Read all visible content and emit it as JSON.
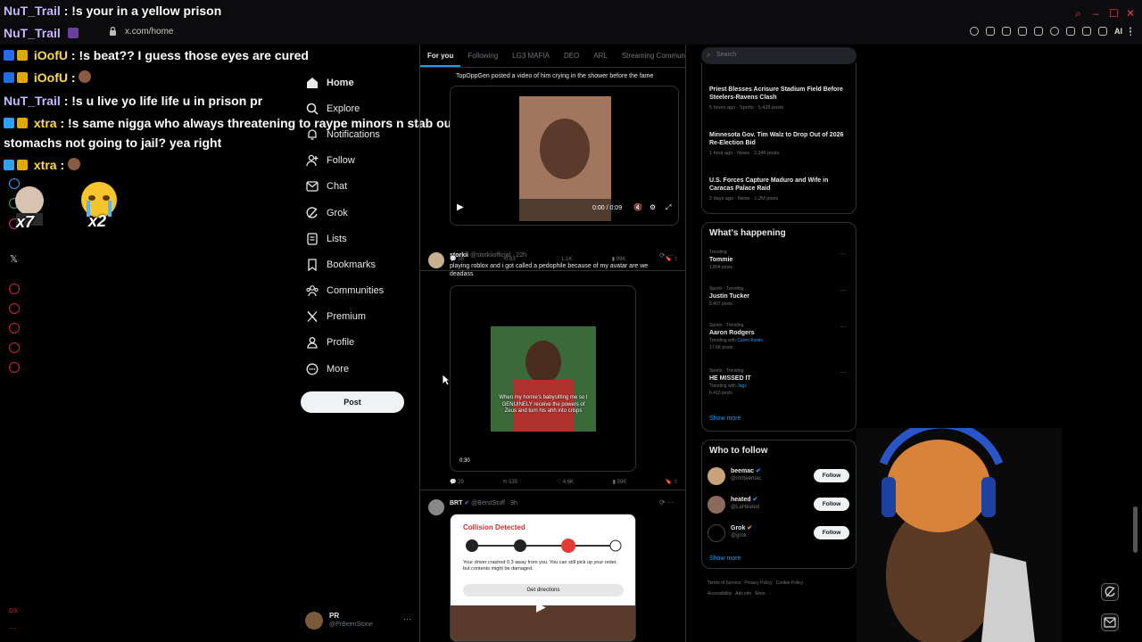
{
  "window": {
    "title_chat": {
      "user": "NuT_Trail",
      "message": ": !s your in a yellow prison"
    },
    "url": "x.com/home",
    "ai_label": "AI"
  },
  "chat": [
    {
      "user": "NuT_Trail",
      "message": "",
      "color": "#c9b7ff"
    },
    {
      "user": "iOofU",
      "message": ": !s beat?? I guess those eyes are cured",
      "color": "#ffd94a"
    },
    {
      "user": "iOofU",
      "message": ":",
      "color": "#ffd94a"
    },
    {
      "user": "NuT_Trail",
      "message": ": !s u live yo life life u in prison pr",
      "color": "#c9b7ff"
    },
    {
      "user": "xtra",
      "message": ": !s same nigga who always threatening to raype minors n stab our",
      "color": "#ffd94a"
    },
    {
      "user": "",
      "message": "stomachs not going to jail? yea right",
      "color": "#ffffff"
    },
    {
      "user": "xtra",
      "message": ":",
      "color": "#ffd94a"
    }
  ],
  "emote_labels": [
    "x7",
    "x2"
  ],
  "nav": {
    "items": [
      {
        "label": "Home",
        "icon": "home-icon",
        "active": true
      },
      {
        "label": "Explore",
        "icon": "search-icon",
        "active": false
      },
      {
        "label": "Notifications",
        "icon": "bell-icon",
        "active": false
      },
      {
        "label": "Follow",
        "icon": "follow-icon",
        "active": false
      },
      {
        "label": "Chat",
        "icon": "chat-icon",
        "active": false
      },
      {
        "label": "Grok",
        "icon": "grok-icon",
        "active": false
      },
      {
        "label": "Lists",
        "icon": "lists-icon",
        "active": false
      },
      {
        "label": "Bookmarks",
        "icon": "bookmark-icon",
        "active": false
      },
      {
        "label": "Communities",
        "icon": "communities-icon",
        "active": false
      },
      {
        "label": "Premium",
        "icon": "x-logo-icon",
        "active": false
      },
      {
        "label": "Profile",
        "icon": "profile-icon",
        "active": false
      },
      {
        "label": "More",
        "icon": "more-icon",
        "active": false
      }
    ],
    "post_label": "Post",
    "me": {
      "name": "PR",
      "handle": "@PrBeenStone",
      "more": "···"
    }
  },
  "feed": {
    "tabs": [
      "For you",
      "Following",
      "LG3 MAFIA",
      "DEO",
      "ARL",
      "Streaming Community"
    ],
    "post1": {
      "text": "TopOppGen posted a video of him crying in the shower before the fame",
      "time": "0:00 / 0:09",
      "replies": "38",
      "reposts": "83",
      "likes": "1.1K",
      "views": "99K"
    },
    "post2": {
      "name": "storkii",
      "handle": "@storkiiofficial",
      "time": "· 22h",
      "text": "playing roblox and i got called a pedophile because of my avatar are we deadass",
      "caption": "When my homie's babysitting me so I GENUINELY receive the powers of Zeus and turn his ahh into crisps",
      "duration": "0:30",
      "replies": "29",
      "reposts": "535",
      "likes": "4.6K",
      "views": "59K"
    },
    "post3": {
      "name": "BRT",
      "handle": "@BerstStuff",
      "time": "· 9h",
      "card_title": "Collision Detected",
      "card_text": "Your driver crashed 0.3 away from you. You can still pick up your order, but contents might be damaged.",
      "card_button": "Get directions"
    }
  },
  "right": {
    "search_placeholder": "Search",
    "news": [
      {
        "title": "Priest Blesses Acrisure Stadium Field Before Steelers-Ravens Clash",
        "meta": "5 hours ago · Sports · 5,428 posts"
      },
      {
        "title": "Minnesota Gov. Tim Walz to Drop Out of 2026 Re-Election Bid",
        "meta": "1 hour ago · News · 2,346 posts"
      },
      {
        "title": "U.S. Forces Capture Maduro and Wife in Caracas Palace Raid",
        "meta": "2 days ago · News · 1.2M posts"
      }
    ],
    "happening_title": "What's happening",
    "trends": [
      {
        "category": "Trending",
        "name": "Tommie",
        "posts": "1,894 posts",
        "with": ""
      },
      {
        "category": "Sports · Trending",
        "name": "Justin Tucker",
        "posts": "5,407 posts",
        "with": ""
      },
      {
        "category": "Sports · Trending",
        "name": "Aaron Rodgers",
        "posts": "17.6K posts",
        "with": "Calvin Austin"
      },
      {
        "category": "Sports · Trending",
        "name": "HE MISSED IT",
        "posts": "6,413 posts",
        "with": "Jags"
      }
    ],
    "trending_with": "Trending with",
    "show_more": "Show more",
    "wtf_title": "Who to follow",
    "wtf": [
      {
        "name": "beemac",
        "handle": "@mrbeemac",
        "button": "Follow"
      },
      {
        "name": "heated",
        "handle": "@LaHeated",
        "button": "Follow"
      },
      {
        "name": "Grok",
        "handle": "@grok",
        "button": "Follow"
      }
    ],
    "footer": [
      "Terms of Service",
      "Privacy Policy",
      "Cookie Policy",
      "Accessibility",
      "Ads info",
      "More ···"
    ]
  }
}
